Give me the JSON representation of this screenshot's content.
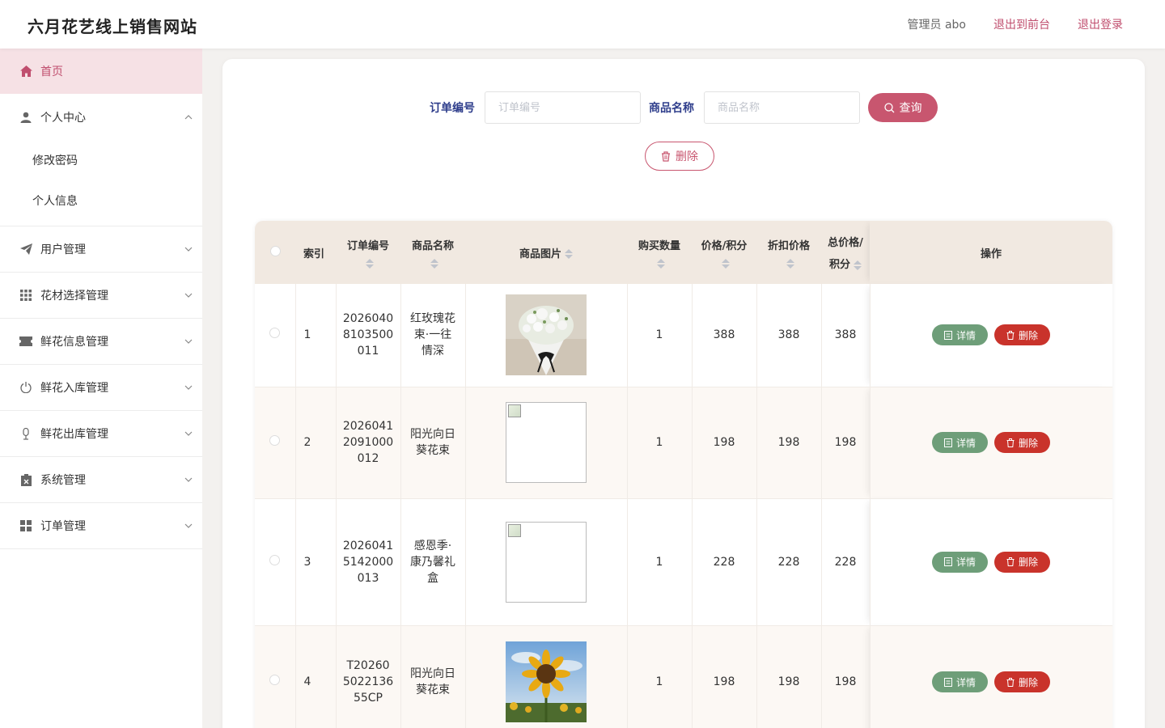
{
  "header": {
    "site_title": "六月花艺线上销售网站",
    "admin_label": "管理员 abo",
    "to_front": "退出到前台",
    "logout": "退出登录"
  },
  "sidebar": {
    "home": "首页",
    "personal_center": "个人中心",
    "change_password": "修改密码",
    "personal_info": "个人信息",
    "items": [
      "用户管理",
      "花材选择管理",
      "鲜花信息管理",
      "鲜花入库管理",
      "鲜花出库管理",
      "系统管理",
      "订单管理"
    ]
  },
  "search": {
    "order_label": "订单编号",
    "order_placeholder": "订单编号",
    "product_label": "商品名称",
    "product_placeholder": "商品名称",
    "query_label": "查询",
    "delete_label": "删除"
  },
  "table": {
    "headers": {
      "index": "索引",
      "order_no": "订单编号",
      "product_name": "商品名称",
      "product_image": "商品图片",
      "quantity": "购买数量",
      "price": "价格/积分",
      "discount": "折扣价格",
      "total_line1": "总价格/",
      "total_line2": "积分",
      "actions": "操作"
    },
    "detail_label": "详情",
    "delete_label": "删除",
    "rows": [
      {
        "index": "1",
        "order_no": "2026040\n8103500\n011",
        "name": "红玫瑰花\n束·一往\n情深",
        "image": "white-bouquet",
        "qty": "1",
        "price": "388",
        "discount": "388",
        "total": "388"
      },
      {
        "index": "2",
        "order_no": "2026041\n2091000\n012",
        "name": "阳光向日\n葵花束",
        "image": "broken",
        "qty": "1",
        "price": "198",
        "discount": "198",
        "total": "198"
      },
      {
        "index": "3",
        "order_no": "2026041\n5142000\n013",
        "name": "感恩季·\n康乃馨礼\n盒",
        "image": "broken",
        "qty": "1",
        "price": "228",
        "discount": "228",
        "total": "228"
      },
      {
        "index": "4",
        "order_no": "T20260\n5022136\n55CP",
        "name": "阳光向日\n葵花束",
        "image": "sunflower",
        "qty": "1",
        "price": "198",
        "discount": "198",
        "total": "198"
      }
    ]
  },
  "colors": {
    "accent": "#c8566f",
    "label_blue": "#2f3e8c",
    "detail_green": "#6e9e79",
    "delete_red": "#c9332b",
    "header_bg": "#f1e9e1"
  }
}
